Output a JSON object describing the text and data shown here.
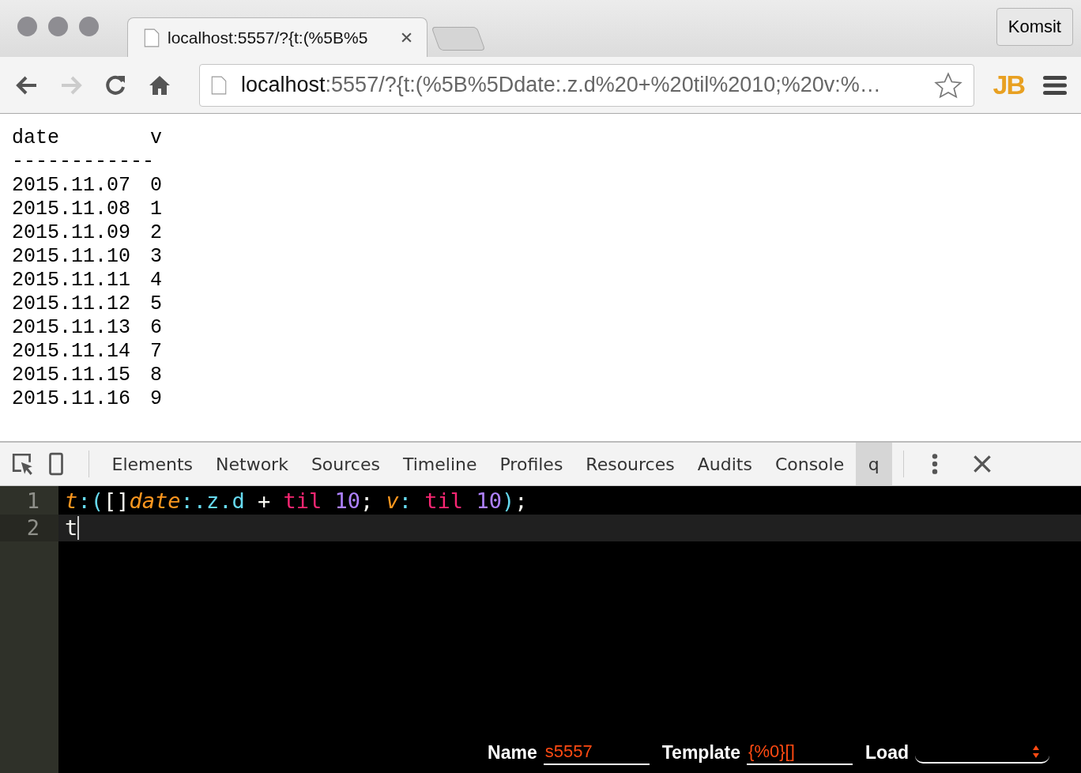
{
  "browser": {
    "tab": {
      "title": "localhost:5557/?{t:(%5B%5",
      "selected": true
    },
    "profile_button": "Komsit",
    "address": {
      "host": "localhost",
      "rest": ":5557/?{t:(%5B%5Ddate:.z.d%20+%20til%2010;%20v:%…"
    },
    "extension_badge": "JB",
    "forward_disabled": true
  },
  "page": {
    "columns": [
      "date",
      "v"
    ],
    "separator": "------------",
    "rows": [
      [
        "2015.11.07",
        "0"
      ],
      [
        "2015.11.08",
        "1"
      ],
      [
        "2015.11.09",
        "2"
      ],
      [
        "2015.11.10",
        "3"
      ],
      [
        "2015.11.11",
        "4"
      ],
      [
        "2015.11.12",
        "5"
      ],
      [
        "2015.11.13",
        "6"
      ],
      [
        "2015.11.14",
        "7"
      ],
      [
        "2015.11.15",
        "8"
      ],
      [
        "2015.11.16",
        "9"
      ]
    ]
  },
  "devtools": {
    "tabs": [
      {
        "label": "Elements",
        "selected": false
      },
      {
        "label": "Network",
        "selected": false
      },
      {
        "label": "Sources",
        "selected": false
      },
      {
        "label": "Timeline",
        "selected": false
      },
      {
        "label": "Profiles",
        "selected": false
      },
      {
        "label": "Resources",
        "selected": false
      },
      {
        "label": "Audits",
        "selected": false
      },
      {
        "label": "Console",
        "selected": false
      },
      {
        "label": "q",
        "selected": true
      }
    ],
    "editor": {
      "lines": [
        {
          "number": "1",
          "active": false,
          "tokens": [
            {
              "text": "t",
              "kind": "name"
            },
            {
              "text": ":(",
              "kind": "punct"
            },
            {
              "text": "[]",
              "kind": "plain"
            },
            {
              "text": "date",
              "kind": "name"
            },
            {
              "text": ":.z.d",
              "kind": "punct"
            },
            {
              "text": " + ",
              "kind": "plain"
            },
            {
              "text": "til ",
              "kind": "keyword"
            },
            {
              "text": "10",
              "kind": "number"
            },
            {
              "text": "; ",
              "kind": "plain"
            },
            {
              "text": "v",
              "kind": "name"
            },
            {
              "text": ": ",
              "kind": "punct"
            },
            {
              "text": "til ",
              "kind": "keyword"
            },
            {
              "text": "10",
              "kind": "number"
            },
            {
              "text": ")",
              "kind": "punct"
            },
            {
              "text": ";",
              "kind": "plain"
            }
          ]
        },
        {
          "number": "2",
          "active": true,
          "tokens": [
            {
              "text": "t",
              "kind": "plain"
            }
          ]
        }
      ]
    },
    "footer": {
      "name_label": "Name",
      "name_value": "s5557",
      "template_label": "Template",
      "template_value": "{%0}[]",
      "load_label": "Load"
    }
  }
}
